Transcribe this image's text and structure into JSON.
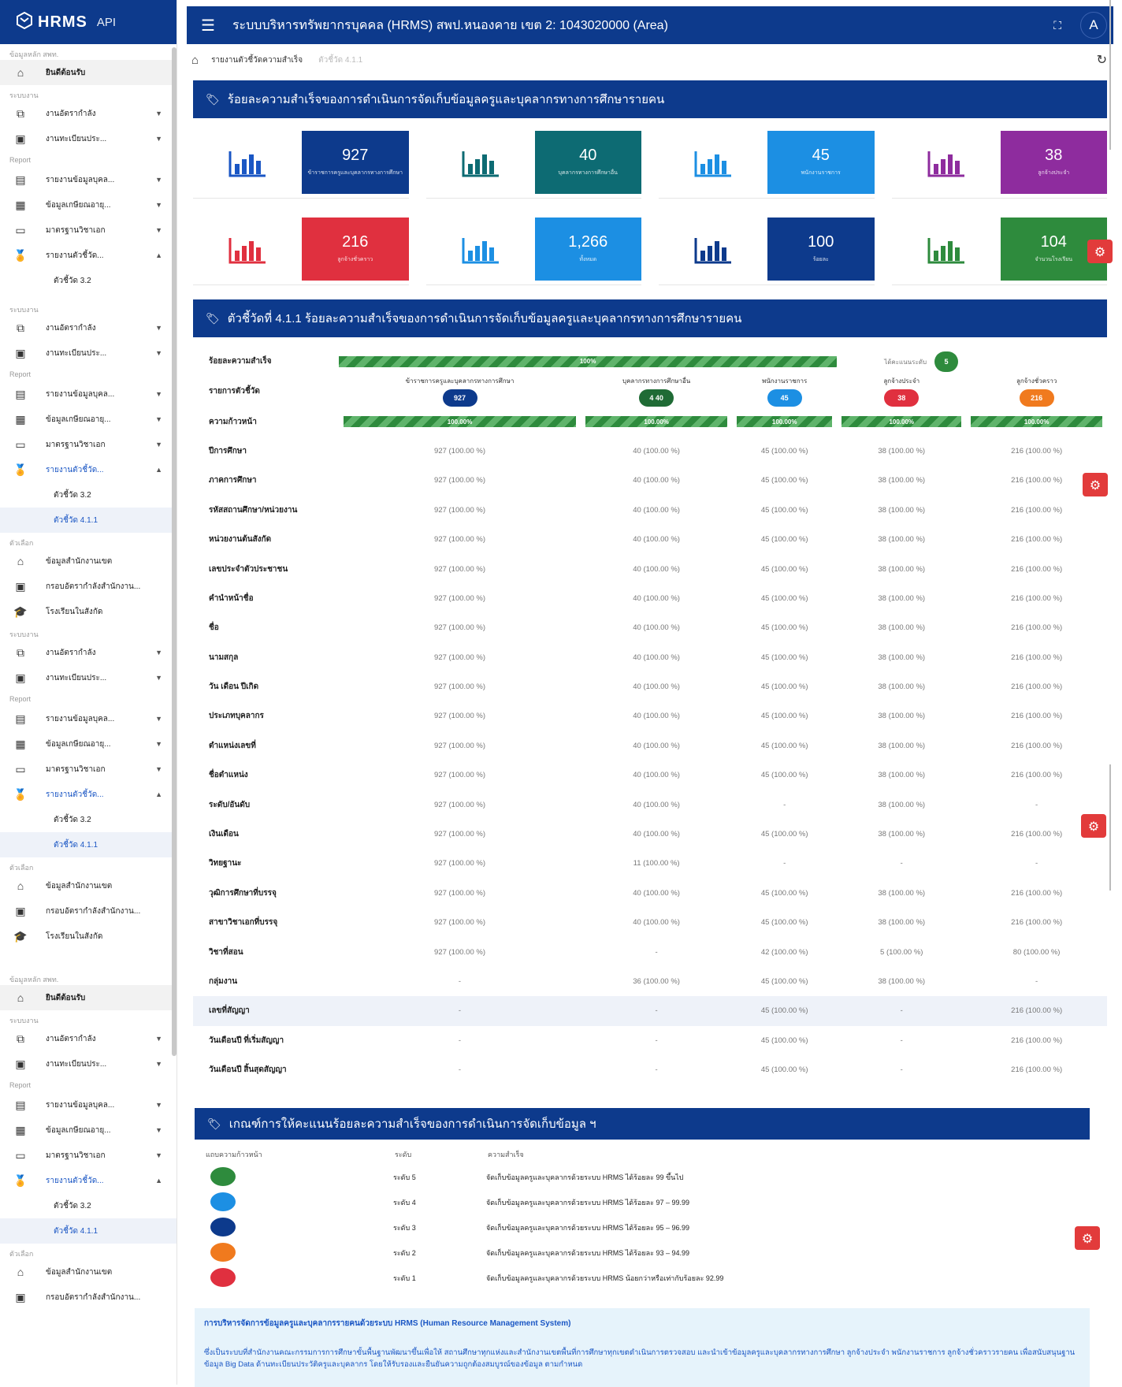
{
  "app": {
    "logo": "HRMS",
    "api": "API",
    "title": "ระบบบริหารทรัพยากรบุคคล (HRMS) สพป.หนองคาย เขต 2: 1043020000 (Area)",
    "avatar": "A"
  },
  "breadcrumb": {
    "current": "รายงานตัวชี้วัดความสำเร็จ",
    "sub": "ตัวชี้วัด 4.1.1"
  },
  "sidebar": {
    "sec1": "ข้อมูลหลัก สพท.",
    "home": "ยินดีต้อนรับ",
    "sec2": "ระบบงาน",
    "item_org": "งานอัตรากำลัง",
    "item_reg": "งานทะเบียนประ...",
    "sec3": "Report",
    "item_rep": "รายงานข้อมูลบุคล...",
    "item_retire": "ข้อมูลเกษียณอายุ...",
    "item_std": "มาตรฐานวิชาเอก",
    "item_kpi": "รายงานตัวชี้วัด...",
    "sub32": "ตัวชี้วัด 3.2",
    "sub411": "ตัวชี้วัด 4.1.1",
    "sec4": "ตัวเลือก",
    "item_office": "ข้อมูลสำนักงานเขต",
    "item_frame": "กรอบอัตรากำลังสำนักงาน...",
    "item_school": "โรงเรียนในสังกัด"
  },
  "panel1": {
    "title": "ร้อยละความสำเร็จของการดำเนินการจัดเก็บข้อมูลครูและบุคลากรทางการศึกษารายคน"
  },
  "cards": [
    {
      "value": "927",
      "label": "ข้าราชการครูและบุคลากรทางการศึกษา",
      "color": "#0d3a8c",
      "bar": "#1a56c4"
    },
    {
      "value": "40",
      "label": "บุคลากรทางการศึกษาอื่น",
      "color": "#0d6b73",
      "bar": "#0d6b73"
    },
    {
      "value": "45",
      "label": "พนักงานราชการ",
      "color": "#1c8fe3",
      "bar": "#1c8fe3"
    },
    {
      "value": "38",
      "label": "ลูกจ้างประจำ",
      "color": "#8e2c9e",
      "bar": "#8e2c9e"
    },
    {
      "value": "216",
      "label": "ลูกจ้างชั่วคราว",
      "color": "#e0303f",
      "bar": "#e0303f"
    },
    {
      "value": "1,266",
      "label": "ทั้งหมด",
      "color": "#1c8fe3",
      "bar": "#1c8fe3"
    },
    {
      "value": "100",
      "label": "ร้อยละ",
      "color": "#0d3a8c",
      "bar": "#0d3a8c"
    },
    {
      "value": "104",
      "label": "จำนวนโรงเรียน",
      "color": "#2e8b3d",
      "bar": "#2e8b3d"
    }
  ],
  "panel2": {
    "title": "ตัวชี้วัดที่ 4.1.1 ร้อยละความสำเร็จของการดำเนินการจัดเก็บข้อมูลครูและบุคลากรทางการศึกษารายคน"
  },
  "indicator": {
    "success_label": "ร้อยละความสำเร็จ",
    "success_value": "100%",
    "level_label": "ได้คะแนนระดับ",
    "level_value": "5",
    "list_label": "รายการตัวชี้วัด",
    "progress_label": "ความก้าวหน้า",
    "columns": [
      {
        "name": "ข้าราชการครูและบุคลากรทางการศึกษา",
        "count": "927",
        "color": "#0d3a8c",
        "progress": "100.00%"
      },
      {
        "name": "บุคลากรทางการศึกษาอื่น",
        "count": "4  40",
        "color": "#1f6b35",
        "progress": "100.00%"
      },
      {
        "name": "พนักงานราชการ",
        "count": "45",
        "color": "#1c8fe3",
        "progress": "100.00%"
      },
      {
        "name": "ลูกจ้างประจำ",
        "count": "38",
        "color": "#e0303f",
        "progress": "100.00%"
      },
      {
        "name": "ลูกจ้างชั่วคราว",
        "count": "216",
        "color": "#f07a1e",
        "progress": "100.00%"
      }
    ],
    "rows": [
      {
        "label": "ปีการศึกษา",
        "v": [
          "927 (100.00 %)",
          "40 (100.00 %)",
          "45 (100.00 %)",
          "38 (100.00 %)",
          "216 (100.00 %)"
        ]
      },
      {
        "label": "ภาคการศึกษา",
        "v": [
          "927 (100.00 %)",
          "40 (100.00 %)",
          "45 (100.00 %)",
          "38 (100.00 %)",
          "216 (100.00 %)"
        ]
      },
      {
        "label": "รหัสสถานศึกษา/หน่วยงาน",
        "v": [
          "927 (100.00 %)",
          "40 (100.00 %)",
          "45 (100.00 %)",
          "38 (100.00 %)",
          "216 (100.00 %)"
        ]
      },
      {
        "label": "หน่วยงานต้นสังกัด",
        "v": [
          "927 (100.00 %)",
          "40 (100.00 %)",
          "45 (100.00 %)",
          "38 (100.00 %)",
          "216 (100.00 %)"
        ]
      },
      {
        "label": "เลขประจำตัวประชาชน",
        "v": [
          "927 (100.00 %)",
          "40 (100.00 %)",
          "45 (100.00 %)",
          "38 (100.00 %)",
          "216 (100.00 %)"
        ]
      },
      {
        "label": "คำนำหน้าชื่อ",
        "v": [
          "927 (100.00 %)",
          "40 (100.00 %)",
          "45 (100.00 %)",
          "38 (100.00 %)",
          "216 (100.00 %)"
        ]
      },
      {
        "label": "ชื่อ",
        "v": [
          "927 (100.00 %)",
          "40 (100.00 %)",
          "45 (100.00 %)",
          "38 (100.00 %)",
          "216 (100.00 %)"
        ]
      },
      {
        "label": "นามสกุล",
        "v": [
          "927 (100.00 %)",
          "40 (100.00 %)",
          "45 (100.00 %)",
          "38 (100.00 %)",
          "216 (100.00 %)"
        ]
      },
      {
        "label": "วัน เดือน ปีเกิด",
        "v": [
          "927 (100.00 %)",
          "40 (100.00 %)",
          "45 (100.00 %)",
          "38 (100.00 %)",
          "216 (100.00 %)"
        ]
      },
      {
        "label": "ประเภทบุคลากร",
        "v": [
          "927 (100.00 %)",
          "40 (100.00 %)",
          "45 (100.00 %)",
          "38 (100.00 %)",
          "216 (100.00 %)"
        ]
      },
      {
        "label": "ตำแหน่งเลขที่",
        "v": [
          "927 (100.00 %)",
          "40 (100.00 %)",
          "45 (100.00 %)",
          "38 (100.00 %)",
          "216 (100.00 %)"
        ]
      },
      {
        "label": "ชื่อตำแหน่ง",
        "v": [
          "927 (100.00 %)",
          "40 (100.00 %)",
          "45 (100.00 %)",
          "38 (100.00 %)",
          "216 (100.00 %)"
        ]
      },
      {
        "label": "ระดับ/อันดับ",
        "v": [
          "927 (100.00 %)",
          "40 (100.00 %)",
          "-",
          "38 (100.00 %)",
          "-"
        ]
      },
      {
        "label": "เงินเดือน",
        "v": [
          "927 (100.00 %)",
          "40 (100.00 %)",
          "45 (100.00 %)",
          "38 (100.00 %)",
          "216 (100.00 %)"
        ]
      },
      {
        "label": "วิทยฐานะ",
        "v": [
          "927 (100.00 %)",
          "11 (100.00 %)",
          "-",
          "-",
          "-"
        ]
      },
      {
        "label": "วุฒิการศึกษาที่บรรจุ",
        "v": [
          "927 (100.00 %)",
          "40 (100.00 %)",
          "45 (100.00 %)",
          "38 (100.00 %)",
          "216 (100.00 %)"
        ]
      },
      {
        "label": "สาขาวิชาเอกที่บรรจุ",
        "v": [
          "927 (100.00 %)",
          "40 (100.00 %)",
          "45 (100.00 %)",
          "38 (100.00 %)",
          "216 (100.00 %)"
        ]
      },
      {
        "label": "วิชาที่สอน",
        "v": [
          "927 (100.00 %)",
          "-",
          "42 (100.00 %)",
          "5 (100.00 %)",
          "80 (100.00 %)"
        ]
      },
      {
        "label": "กลุ่มงาน",
        "v": [
          "-",
          "36 (100.00 %)",
          "45 (100.00 %)",
          "38 (100.00 %)",
          "-"
        ]
      },
      {
        "label": "เลขที่สัญญา",
        "v": [
          "-",
          "-",
          "45 (100.00 %)",
          "-",
          "216 (100.00 %)"
        ]
      },
      {
        "label": "วันเดือนปี ที่เริ่มสัญญา",
        "v": [
          "-",
          "-",
          "45 (100.00 %)",
          "-",
          "216 (100.00 %)"
        ]
      },
      {
        "label": "วันเดือนปี สิ้นสุดสัญญา",
        "v": [
          "-",
          "-",
          "45 (100.00 %)",
          "-",
          "216 (100.00 %)"
        ]
      }
    ]
  },
  "panel3": {
    "title": "เกณฑ์การให้คะแนนร้อยละความสำเร็จของการดำเนินการจัดเก็บข้อมูล ฯ"
  },
  "criteria": {
    "h_color": "แถบความก้าวหน้า",
    "h_level": "ระดับ",
    "h_desc": "ความสำเร็จ",
    "rows": [
      {
        "color": "#2e8b3d",
        "level": "ระดับ 5",
        "desc": "จัดเก็บข้อมูลครูและบุคลากรด้วยระบบ HRMS ได้ร้อยละ 99 ขึ้นไป"
      },
      {
        "color": "#1c8fe3",
        "level": "ระดับ 4",
        "desc": "จัดเก็บข้อมูลครูและบุคลากรด้วยระบบ HRMS ได้ร้อยละ 97 – 99.99"
      },
      {
        "color": "#0d3a8c",
        "level": "ระดับ 3",
        "desc": "จัดเก็บข้อมูลครูและบุคลากรด้วยระบบ HRMS ได้ร้อยละ 95 – 96.99"
      },
      {
        "color": "#f07a1e",
        "level": "ระดับ 2",
        "desc": "จัดเก็บข้อมูลครูและบุคลากรด้วยระบบ HRMS ได้ร้อยละ 93 – 94.99"
      },
      {
        "color": "#e0303f",
        "level": "ระดับ 1",
        "desc": "จัดเก็บข้อมูลครูและบุคลากรด้วยระบบ HRMS น้อยกว่าหรือเท่ากับร้อยละ 92.99"
      }
    ]
  },
  "note": {
    "title": "การบริหารจัดการข้อมูลครูและบุคลากรรายคนด้วยระบบ HRMS (Human Resource Management System)",
    "body": "ซึ่งเป็นระบบที่สำนักงานคณะกรรมการการศึกษาขั้นพื้นฐานพัฒนาขึ้นเพื่อให้ สถานศึกษาทุกแห่งและสำนักงานเขตพื้นที่การศึกษาทุกเขตดำเนินการตรวจสอบ และนำเข้าข้อมูลครูและบุคลากรทางการศึกษา ลูกจ้างประจำ พนักงานราชการ ลูกจ้างชั่วคราวรายคน เพื่อสนับสนุนฐานข้อมูล Big Data ด้านทะเบียนประวัติครูและบุคลากร โดยให้รับรองและยืนยันความถูกต้องสมบูรณ์ของข้อมูล ตามกำหนด"
  }
}
